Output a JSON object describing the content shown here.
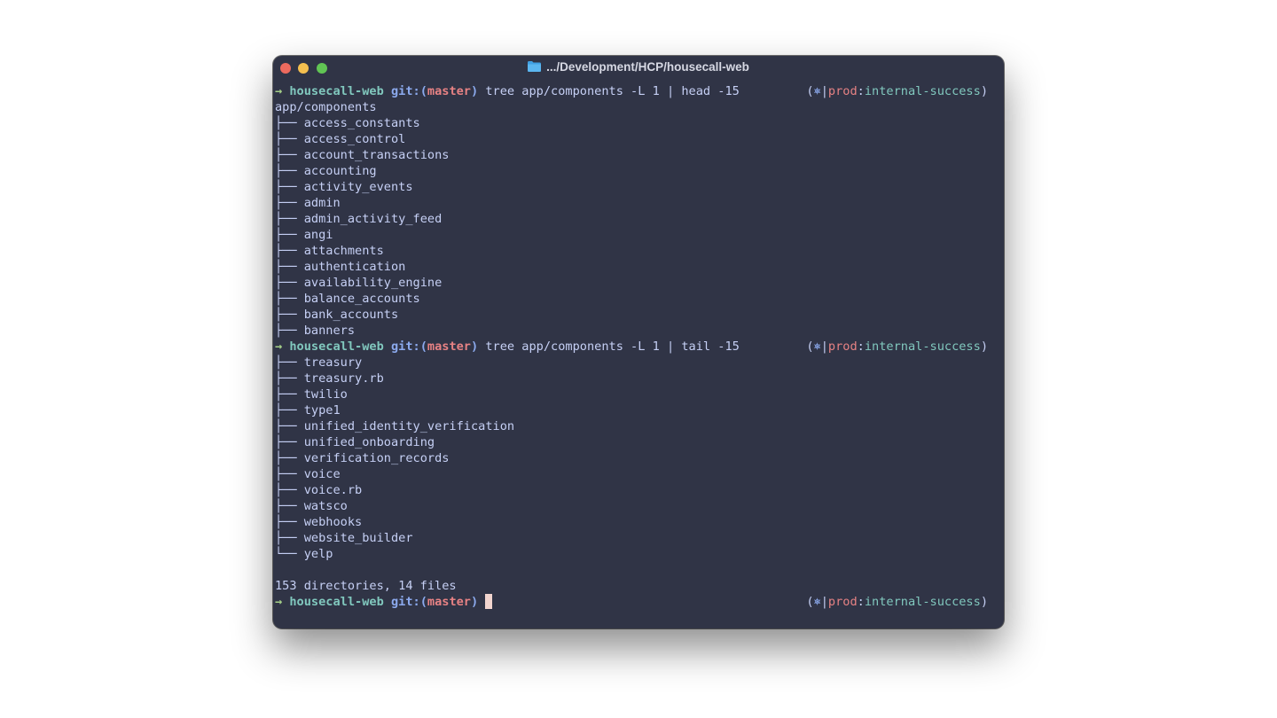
{
  "window": {
    "title": ".../Development/HCP/housecall-web",
    "folder_icon": "folder-icon",
    "controls": [
      "close",
      "minimize",
      "maximize"
    ]
  },
  "colors": {
    "background": "#303446",
    "arrow": "#a6d189",
    "repo": "#81c8be",
    "git": "#8caaee",
    "branch": "#e78284",
    "text": "#c6d0f5",
    "cursor": "#f2d5cf"
  },
  "prompt": {
    "arrow": "→",
    "repo": "housecall-web",
    "git_label": "git:(",
    "branch": "master",
    "close_paren": ")"
  },
  "right_prompt": {
    "open": "(",
    "star": "⎈",
    "sep": "|",
    "env": "prod",
    "colon": ":",
    "context": "internal-success",
    "close": ")"
  },
  "commands": {
    "head": "tree app/components -L 1 | head -15",
    "tail": "tree app/components -L 1 | tail -15"
  },
  "head_output": {
    "root": "app/components",
    "entries": [
      "access_constants",
      "access_control",
      "account_transactions",
      "accounting",
      "activity_events",
      "admin",
      "admin_activity_feed",
      "angi",
      "attachments",
      "authentication",
      "availability_engine",
      "balance_accounts",
      "bank_accounts",
      "banners"
    ]
  },
  "tail_output": {
    "entries": [
      "treasury",
      "treasury.rb",
      "twilio",
      "type1",
      "unified_identity_verification",
      "unified_onboarding",
      "verification_records",
      "voice",
      "voice.rb",
      "watsco",
      "webhooks",
      "website_builder",
      "yelp"
    ],
    "summary": "153 directories, 14 files"
  }
}
